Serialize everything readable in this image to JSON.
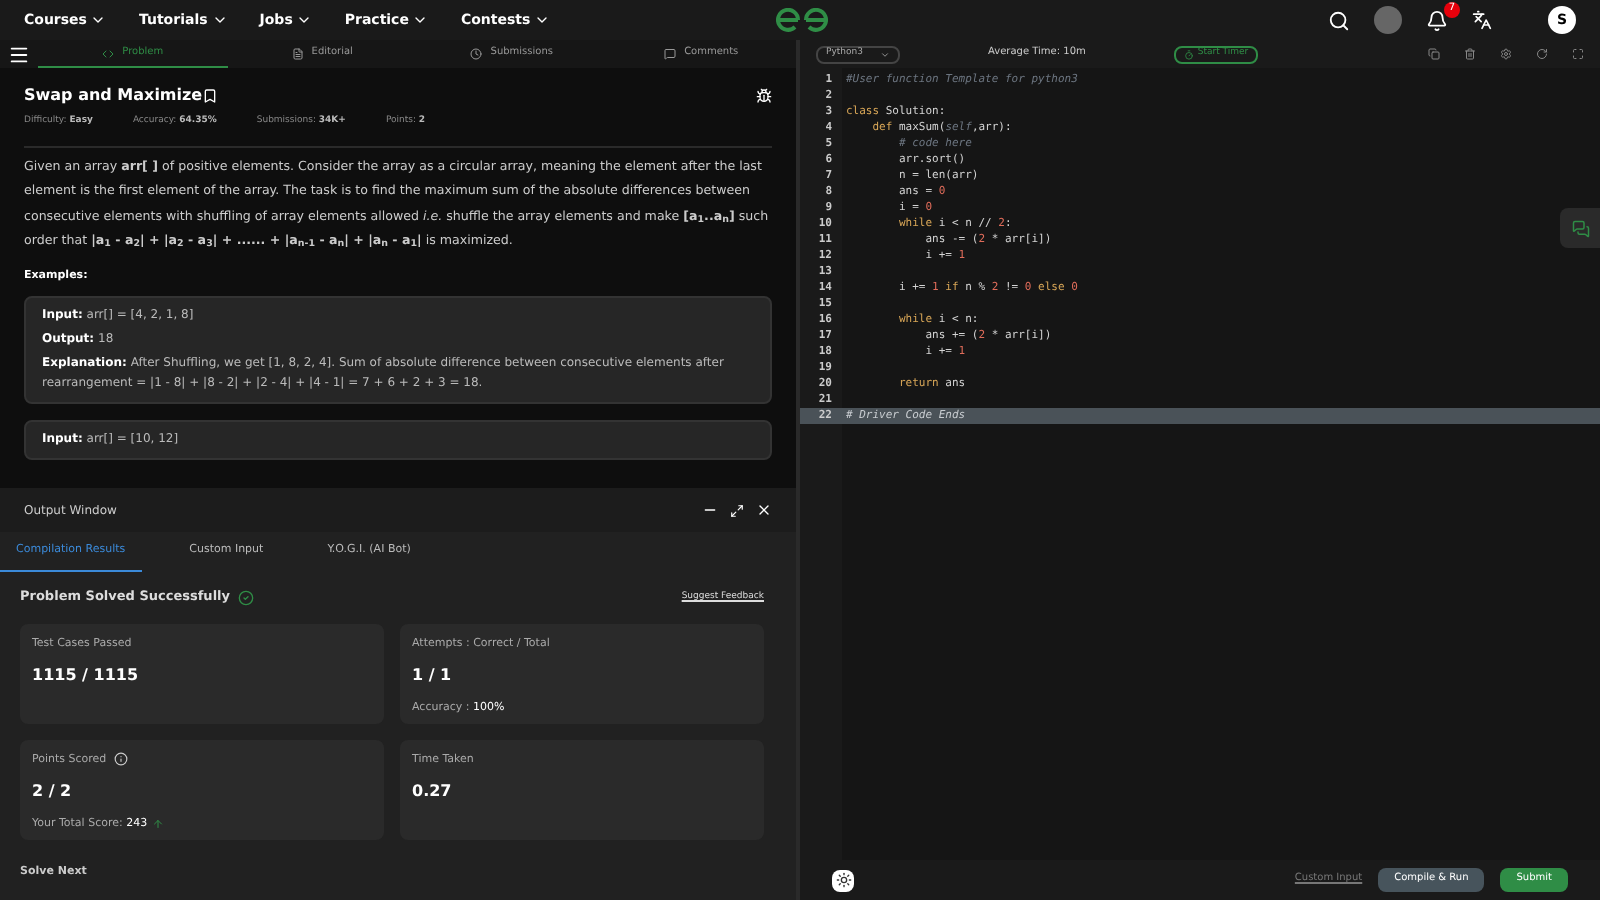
{
  "nav": {
    "menus": [
      "Courses",
      "Tutorials",
      "Jobs",
      "Practice",
      "Contests"
    ],
    "notifications": "7",
    "avatar": "S"
  },
  "tabs": [
    {
      "label": "Problem",
      "selected": true,
      "kind": "code"
    },
    {
      "label": "Editorial",
      "selected": false,
      "kind": "doc"
    },
    {
      "label": "Submissions",
      "selected": false,
      "kind": "clock"
    },
    {
      "label": "Comments",
      "selected": false,
      "kind": "chat"
    }
  ],
  "problem": {
    "title": "Swap and Maximize",
    "meta": [
      {
        "label": "Difficulty:",
        "value": "Easy"
      },
      {
        "label": "Accuracy:",
        "value": "64.35%"
      },
      {
        "label": "Submissions:",
        "value": "34K+"
      },
      {
        "label": "Points:",
        "value": "2"
      }
    ],
    "description": "Given an array **arr[ ]** of positive elements. Consider the array as a circular array, meaning the element after the last element is the first element of the array. The task is to find the maximum sum of the absolute differences between consecutive elements with shuffling of array elements allowed *i.e.* shuffle the array elements and make **[a$_{1}$..a$_{n}$]** such order that  **|a$_{1}$ - a$_{2}$| + |a$_{2}$ - a$_{3}$| + ...... + |a$_{n-1}$ - a$_{n}$| + |a$_{n}$ - a$_{1}$|** is maximized.",
    "examples_heading": "Examples:",
    "examples": [
      {
        "lines": [
          {
            "label": "Input:",
            "value": "arr[] = [4, 2, 1, 8]"
          },
          {
            "label": "Output:",
            "value": "18"
          },
          {
            "label": "Explanation:",
            "value": "After Shuffling, we get [1, 8, 2, 4]. Sum of absolute difference between consecutive elements after rearrangement = |1 - 8| + |8 - 2| + |2 - 4| + |4 - 1| = 7 + 6 + 2 + 3 = 18."
          }
        ]
      },
      {
        "lines": [
          {
            "label": "Input:",
            "value": "arr[] = [10, 12]"
          }
        ]
      }
    ]
  },
  "output_window": {
    "title": "Output Window",
    "tabs": [
      {
        "label": "Compilation Results",
        "selected": true
      },
      {
        "label": "Custom Input",
        "selected": false
      },
      {
        "label": "Y.O.G.I. (AI Bot)",
        "selected": false
      }
    ],
    "status": "Problem Solved Successfully",
    "feedback": "Suggest Feedback",
    "cards": [
      {
        "label": "Test Cases Passed",
        "value": "1115 / 1115"
      },
      {
        "label": "Attempts : Correct / Total",
        "value": "1 / 1",
        "note_label": "Accuracy :",
        "note_value": "100%"
      },
      {
        "label": "Points Scored",
        "value": "2 / 2",
        "info": true,
        "note_label": "Your Total Score:",
        "note_value": "243",
        "trend_up": true
      },
      {
        "label": "Time Taken",
        "value": "0.27"
      }
    ],
    "solve_next": "Solve Next"
  },
  "editor": {
    "language": "Python3",
    "average_time": "Average Time: 10m",
    "timer": "Start Timer",
    "lines": [
      {
        "number": "1",
        "highlighted": false,
        "tokens": [
          {
            "text": "#User function Template for python3",
            "kind": "comment"
          }
        ]
      },
      {
        "number": "2",
        "highlighted": false
      },
      {
        "number": "3",
        "highlighted": false,
        "tokens": [
          {
            "text": "class ",
            "kind": "keyword"
          },
          {
            "text": "Solution:",
            "kind": "name"
          }
        ]
      },
      {
        "number": "4",
        "highlighted": false,
        "tokens": [
          {
            "text": "    def ",
            "kind": "keyword"
          },
          {
            "text": "maxSum(",
            "kind": "name"
          },
          {
            "text": "self",
            "kind": "comment"
          },
          {
            "text": ",arr):",
            "kind": "name"
          }
        ]
      },
      {
        "number": "5",
        "highlighted": false,
        "tokens": [
          {
            "text": "        # code here",
            "kind": "comment"
          }
        ]
      },
      {
        "number": "6",
        "highlighted": false,
        "tokens": [
          {
            "text": "        arr.sort()",
            "kind": "name"
          }
        ]
      },
      {
        "number": "7",
        "highlighted": false,
        "tokens": [
          {
            "text": "        n = len(arr)",
            "kind": "name"
          }
        ]
      },
      {
        "number": "8",
        "highlighted": false,
        "tokens": [
          {
            "text": "        ans = ",
            "kind": "name"
          },
          {
            "text": "0",
            "kind": "number"
          }
        ]
      },
      {
        "number": "9",
        "highlighted": false,
        "tokens": [
          {
            "text": "        i = ",
            "kind": "name"
          },
          {
            "text": "0",
            "kind": "number"
          }
        ]
      },
      {
        "number": "10",
        "highlighted": false,
        "tokens": [
          {
            "text": "        while ",
            "kind": "keyword"
          },
          {
            "text": "i < n // ",
            "kind": "name"
          },
          {
            "text": "2",
            "kind": "number"
          },
          {
            "text": ":",
            "kind": "name"
          }
        ]
      },
      {
        "number": "11",
        "highlighted": false,
        "tokens": [
          {
            "text": "            ans -= (",
            "kind": "name"
          },
          {
            "text": "2",
            "kind": "number"
          },
          {
            "text": " * arr[i])",
            "kind": "name"
          }
        ]
      },
      {
        "number": "12",
        "highlighted": false,
        "tokens": [
          {
            "text": "            i += ",
            "kind": "name"
          },
          {
            "text": "1",
            "kind": "number"
          }
        ]
      },
      {
        "number": "13",
        "highlighted": false
      },
      {
        "number": "14",
        "highlighted": false,
        "tokens": [
          {
            "text": "        i += ",
            "kind": "name"
          },
          {
            "text": "1",
            "kind": "number"
          },
          {
            "text": " if ",
            "kind": "keyword"
          },
          {
            "text": "n % ",
            "kind": "name"
          },
          {
            "text": "2",
            "kind": "number"
          },
          {
            "text": " != ",
            "kind": "name"
          },
          {
            "text": "0",
            "kind": "number"
          },
          {
            "text": " else ",
            "kind": "keyword"
          },
          {
            "text": "0",
            "kind": "number"
          }
        ]
      },
      {
        "number": "15",
        "highlighted": false
      },
      {
        "number": "16",
        "highlighted": false,
        "tokens": [
          {
            "text": "        while ",
            "kind": "keyword"
          },
          {
            "text": "i < n:",
            "kind": "name"
          }
        ]
      },
      {
        "number": "17",
        "highlighted": false,
        "tokens": [
          {
            "text": "            ans += (",
            "kind": "name"
          },
          {
            "text": "2",
            "kind": "number"
          },
          {
            "text": " * arr[i])",
            "kind": "name"
          }
        ]
      },
      {
        "number": "18",
        "highlighted": false,
        "tokens": [
          {
            "text": "            i += ",
            "kind": "name"
          },
          {
            "text": "1",
            "kind": "number"
          }
        ]
      },
      {
        "number": "19",
        "highlighted": false
      },
      {
        "number": "20",
        "highlighted": false,
        "tokens": [
          {
            "text": "        return ",
            "kind": "keyword"
          },
          {
            "text": "ans",
            "kind": "name"
          }
        ]
      },
      {
        "number": "21",
        "highlighted": false
      },
      {
        "number": "22",
        "highlighted": true,
        "tokens": [
          {
            "text": "# Driver Code Ends",
            "kind": "comment"
          }
        ]
      }
    ]
  },
  "footer": {
    "custom_input": "Custom Input",
    "compile": "Compile & Run",
    "submit": "Submit"
  }
}
